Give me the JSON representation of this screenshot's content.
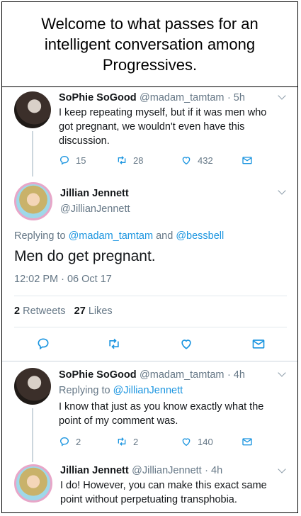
{
  "caption": {
    "line1": "Welcome to what passes for an",
    "line2": "intelligent conversation among",
    "line3": "Progressives."
  },
  "tweet1": {
    "name": "SoPhie SoGood",
    "handle": "@madam_tamtam",
    "time": "· 5h",
    "lines": [
      "I keep repeating myself, but if it was men who",
      "got pregnant, we wouldn't even have this",
      "discussion."
    ],
    "replies": "15",
    "retweets": "28",
    "likes": "432"
  },
  "tweet2": {
    "name": "Jillian Jennett",
    "handle": "@JillianJennett",
    "replying_prefix": "Replying to",
    "replying_to1": "@madam_tamtam",
    "replying_and": "and",
    "replying_to2": "@bessbell",
    "text": "Men do get pregnant.",
    "timestamp": "12:02 PM · 06 Oct 17",
    "retweet_count": "2",
    "retweet_label": "Retweets",
    "like_count": "27",
    "like_label": "Likes"
  },
  "tweet3": {
    "name": "SoPhie SoGood",
    "handle": "@madam_tamtam",
    "time": "· 4h",
    "replying_prefix": "Replying to",
    "replying_to": "@JillianJennett",
    "lines": [
      "I know that just as you know exactly what the",
      "point of my comment was."
    ],
    "replies": "2",
    "retweets": "2",
    "likes": "140"
  },
  "tweet4": {
    "name": "Jillian Jennett",
    "handle": "@JillianJennett",
    "time": "· 4h",
    "lines": [
      "I do! However, you can make this exact same",
      "point without perpetuating transphobia."
    ]
  },
  "colors": {
    "link": "#1b95e0",
    "muted": "#657786",
    "divider": "#e1e8ed"
  },
  "icons": [
    "reply-icon",
    "retweet-icon",
    "like-icon",
    "direct-message-icon",
    "chevron-down-icon"
  ]
}
